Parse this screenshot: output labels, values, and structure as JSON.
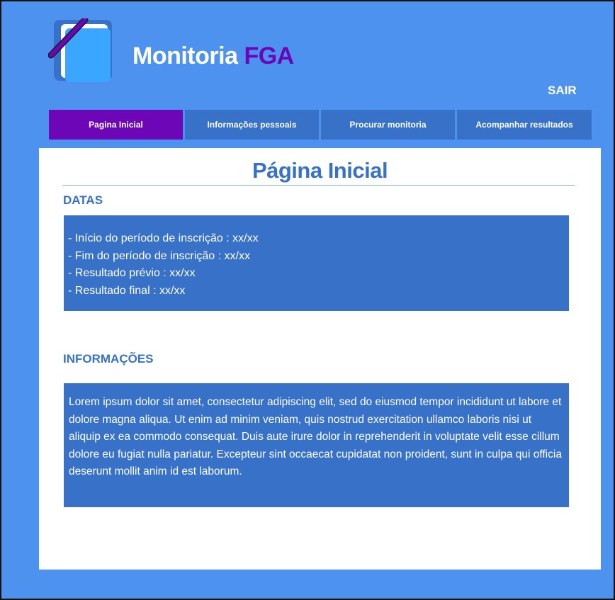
{
  "header": {
    "brand_main": "Monitoria",
    "brand_accent": "FGA",
    "logout_label": "SAIR",
    "logo_icon": "notebook-pen-icon"
  },
  "nav": {
    "tabs": [
      {
        "label": "Pagina Inicial",
        "active": true
      },
      {
        "label": "Informações pessoais",
        "active": false
      },
      {
        "label": "Procurar monitoria",
        "active": false
      },
      {
        "label": "Acompanhar resultados",
        "active": false
      }
    ]
  },
  "main": {
    "title": "Página Inicial",
    "dates_heading": "DATAS",
    "dates": [
      "- Início do período de inscrição : xx/xx",
      "- Fim do período de inscrição : xx/xx",
      "- Resultado prévio : xx/xx",
      "- Resultado final : xx/xx"
    ],
    "info_heading": "INFORMAÇÕES",
    "info_text": "Lorem ipsum dolor sit amet, consectetur adipiscing elit, sed do eiusmod tempor incididunt ut labore et dolore magna aliqua. Ut enim ad minim veniam, quis nostrud exercitation ullamco laboris nisi ut aliquip ex ea commodo consequat. Duis aute irure dolor in reprehenderit in voluptate velit esse cillum dolore eu fugiat nulla pariatur. Excepteur sint occaecat cupidatat non proident, sunt in culpa qui officia deserunt mollit anim id est laborum."
  },
  "colors": {
    "background": "#4d92ef",
    "primary": "#3771c8",
    "accent": "#6c06b6",
    "card": "#ffffff"
  }
}
